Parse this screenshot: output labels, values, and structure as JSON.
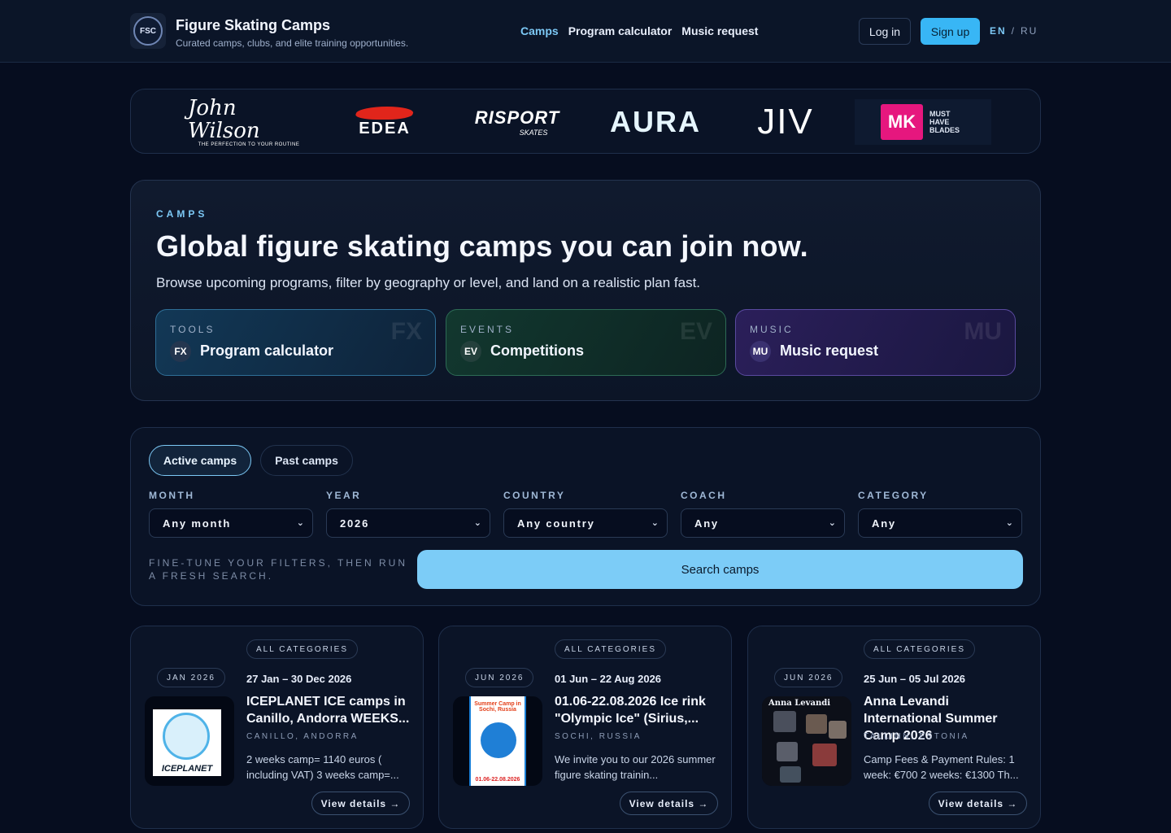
{
  "header": {
    "logo_text": "FSC",
    "title": "Figure Skating Camps",
    "subtitle": "Curated camps, clubs, and elite training opportunities.",
    "nav": [
      {
        "label": "Camps",
        "active": true
      },
      {
        "label": "Program calculator",
        "active": false
      },
      {
        "label": "Music request",
        "active": false
      }
    ],
    "login_label": "Log in",
    "signup_label": "Sign up",
    "lang_en": "EN",
    "lang_sep": "/",
    "lang_ru": "RU"
  },
  "sponsors": {
    "wilson_name": "John Wilson",
    "wilson_tagline": "THE PERFECTION TO YOUR ROUTINE",
    "edea": "EDEA",
    "risport": "RISPORT",
    "risport_sub": "SKATES",
    "aura": "AURA",
    "jiv": "JIV",
    "mk": "MK",
    "mk_tag": "MUST HAVE BLADES"
  },
  "hero": {
    "kicker": "CAMPS",
    "title": "Global figure skating camps you can join now.",
    "subtitle": "Browse upcoming programs, filter by geography or level, and land on a realistic plan fast.",
    "tiles": [
      {
        "kicker": "TOOLS",
        "badge": "FX",
        "label": "Program calculator",
        "ghost": "FX"
      },
      {
        "kicker": "EVENTS",
        "badge": "EV",
        "label": "Competitions",
        "ghost": "EV"
      },
      {
        "kicker": "MUSIC",
        "badge": "MU",
        "label": "Music request",
        "ghost": "MU"
      }
    ]
  },
  "filters": {
    "tabs": [
      {
        "label": "Active camps",
        "active": true
      },
      {
        "label": "Past camps",
        "active": false
      }
    ],
    "fields": [
      {
        "label": "MONTH",
        "value": "Any month"
      },
      {
        "label": "YEAR",
        "value": "2026"
      },
      {
        "label": "COUNTRY",
        "value": "Any country"
      },
      {
        "label": "COACH",
        "value": "Any"
      },
      {
        "label": "CATEGORY",
        "value": "Any"
      }
    ],
    "hint": "FINE-TUNE YOUR FILTERS, THEN RUN A FRESH SEARCH.",
    "search_label": "Search camps"
  },
  "cards": [
    {
      "category": "ALL CATEGORIES",
      "month": "JAN 2026",
      "dates": "27 Jan – 30 Dec 2026",
      "title": "ICEPLANET ICE camps in Canillo, Andorra WEEKS...",
      "location": "CANILLO, ANDORRA",
      "desc": "2 weeks camp= 1140 euros ( including VAT) 3 weeks camp=...",
      "button": "View details →",
      "image_text": "ICEPLANET"
    },
    {
      "category": "ALL CATEGORIES",
      "month": "JUN 2026",
      "dates": "01 Jun – 22 Aug 2026",
      "title": "01.06-22.08.2026 Ice rink \"Olympic Ice\" (Sirius,...",
      "location": "SOCHI, RUSSIA",
      "desc": "We invite you to our 2026 summer figure skating trainin...",
      "button": "View details →",
      "image_text_top": "Summer Camp in Sochi, Russia",
      "image_text_bottom": "01.06-22.08.2026"
    },
    {
      "category": "ALL CATEGORIES",
      "month": "JUN 2026",
      "dates": "25 Jun – 05 Jul 2026",
      "title": "Anna Levandi International Summer Camp 2026",
      "location": "TALLINN, ESTONIA",
      "desc": "Camp Fees & Payment Rules: 1 week: €700 2 weeks: €1300 Th...",
      "button": "View details →",
      "image_text": "Anna Levandi"
    }
  ],
  "icons": {
    "chevron": "chevron-down-icon"
  },
  "colors": {
    "accent": "#7cc8f5",
    "signup": "#38b6f5",
    "background": "#060d1f"
  }
}
